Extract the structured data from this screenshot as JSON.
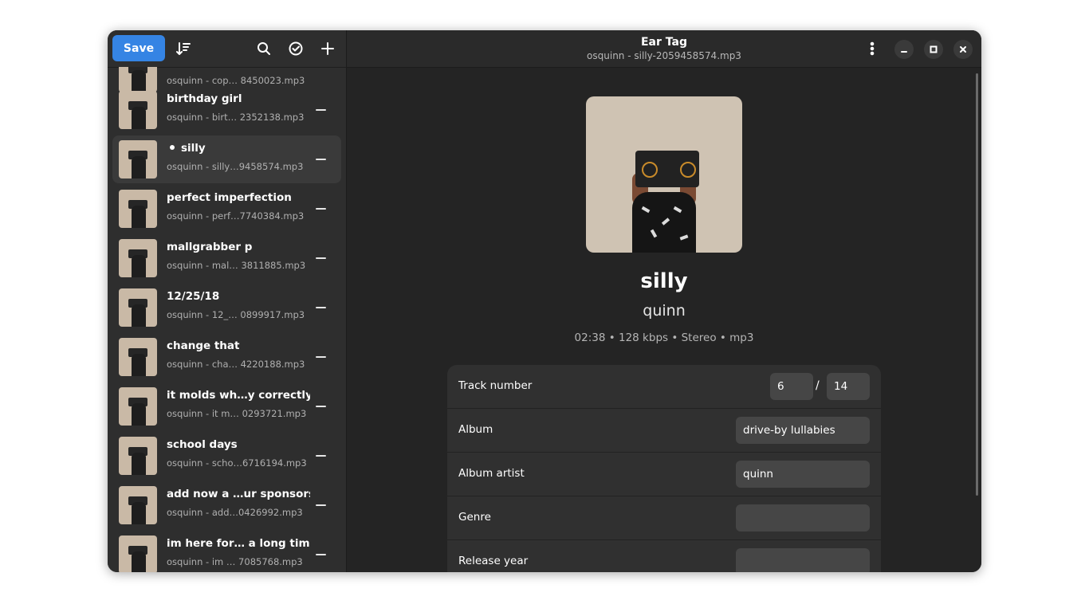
{
  "header": {
    "save_label": "Save",
    "title": "Ear Tag",
    "subtitle": "osquinn - silly-2059458574.mp3"
  },
  "icons": {
    "sort": "sort-icon",
    "search": "search-icon",
    "select": "check-circle-icon",
    "add": "plus-icon",
    "menu": "kebab-menu-icon",
    "minimize": "minimize-icon",
    "maximize": "maximize-icon",
    "close": "close-icon"
  },
  "files": [
    {
      "title": "",
      "subtitle": "osquinn - cop… 8450023.mp3"
    },
    {
      "title": "birthday girl",
      "subtitle": "osquinn - birt… 2352138.mp3"
    },
    {
      "title": "silly",
      "subtitle": "osquinn - silly…9458574.mp3",
      "selected": true,
      "modified": true
    },
    {
      "title": "perfect imperfection",
      "subtitle": "osquinn - perf…7740384.mp3"
    },
    {
      "title": "mallgrabber p",
      "subtitle": "osquinn - mal… 3811885.mp3"
    },
    {
      "title": "12/25/18",
      "subtitle": "osquinn - 12_… 0899917.mp3"
    },
    {
      "title": "change that",
      "subtitle": "osquinn - cha… 4220188.mp3"
    },
    {
      "title": "it molds wh…y correctly",
      "subtitle": "osquinn - it m… 0293721.mp3"
    },
    {
      "title": "school days",
      "subtitle": "osquinn - scho…6716194.mp3"
    },
    {
      "title": "add now a …ur sponsors",
      "subtitle": "osquinn - add…0426992.mp3"
    },
    {
      "title": "im here for… a long time",
      "subtitle": "osquinn - im … 7085768.mp3"
    }
  ],
  "song": {
    "title": "silly",
    "artist": "quinn",
    "info": "02:38 • 128 kbps • Stereo • mp3"
  },
  "fields": {
    "track_label": "Track number",
    "track_number": "6",
    "track_total": "14",
    "track_separator": "/",
    "album_label": "Album",
    "album_value": "drive-by lullabies",
    "album_artist_label": "Album artist",
    "album_artist_value": "quinn",
    "genre_label": "Genre",
    "genre_value": "",
    "release_year_label": "Release year",
    "release_year_value": ""
  },
  "colors": {
    "accent": "#3584e4",
    "window_bg": "#242424",
    "sidebar_bg": "#2e2e2e"
  }
}
